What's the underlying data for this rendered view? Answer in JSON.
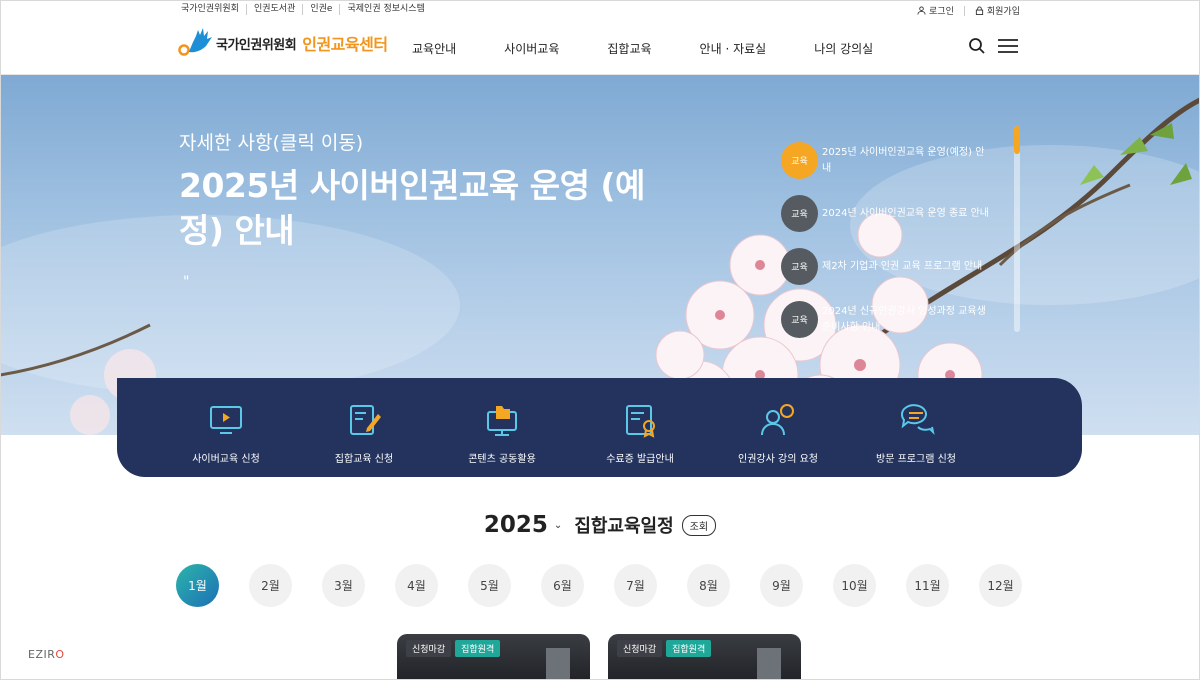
{
  "util": {
    "left_links": [
      "국가인권위원회",
      "인권도서관",
      "인권e",
      "국제인권 정보시스템"
    ],
    "login": "로그인",
    "signup": "회원가입"
  },
  "header": {
    "logo_org": "국가인권위원회",
    "logo_center": "인권교육센터",
    "nav": [
      "교육안내",
      "사이버교육",
      "집합교육",
      "안내 · 자료실",
      "나의 강의실"
    ]
  },
  "hero": {
    "sub": "자세한 사항(클릭 이동)",
    "title": "2025년 사이버인권교육 운영 (예정) 안내",
    "quote": "\"",
    "notices": [
      {
        "badge": "교육",
        "text": "2025년 사이버인권교육 운영(예정) 안내",
        "active": true
      },
      {
        "badge": "교육",
        "text": "2024년 사이버인권교육 운영 종료 안내",
        "active": false
      },
      {
        "badge": "교육",
        "text": "제2차 기업과 인권 교육 프로그램 안내",
        "active": false
      },
      {
        "badge": "교육",
        "text": "2024년 신규인권강사 양성과정 교육생 준비사항 안내",
        "active": false
      }
    ]
  },
  "quick": [
    {
      "label": "사이버교육 신청",
      "icon": "monitor-play-icon"
    },
    {
      "label": "집합교육 신청",
      "icon": "book-pen-icon"
    },
    {
      "label": "콘텐츠 공동활용",
      "icon": "folder-monitor-icon"
    },
    {
      "label": "수료증 발급안내",
      "icon": "certificate-icon"
    },
    {
      "label": "인권강사 강의 요청",
      "icon": "people-chat-icon"
    },
    {
      "label": "방문 프로그램 신청",
      "icon": "chat-bubbles-icon"
    }
  ],
  "schedule": {
    "year": "2025",
    "title": "집합교육일정",
    "button": "조회",
    "months": [
      "1월",
      "2월",
      "3월",
      "4월",
      "5월",
      "6월",
      "7월",
      "8월",
      "9월",
      "10월",
      "11월",
      "12월"
    ],
    "active_month": "1월"
  },
  "cards": [
    {
      "tag1": "신청마감",
      "tag2": "집합원격"
    },
    {
      "tag1": "신청마감",
      "tag2": "집합원격"
    }
  ],
  "watermark": {
    "pre": "EZIR",
    "post": "O"
  },
  "colors": {
    "accent": "#f5a623",
    "navy": "#23335e",
    "teal": "#1fa89a"
  }
}
